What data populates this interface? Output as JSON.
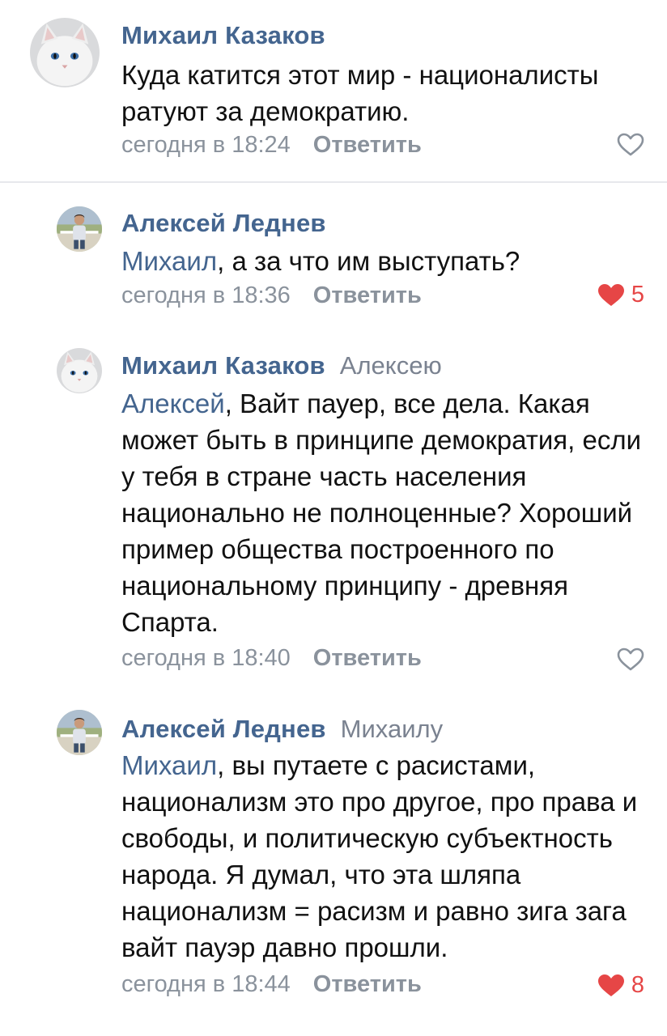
{
  "colors": {
    "author": "#44658f",
    "secondary": "#8a929c",
    "like_active": "#e64646",
    "divider": "#e7e8ec"
  },
  "comments": [
    {
      "author": "Михаил Казаков",
      "reply_to": "",
      "mention": "",
      "text": "Куда катится этот мир - националисты ратуют за демократию.",
      "date": "сегодня в 18:24",
      "reply_label": "Ответить",
      "liked": false,
      "like_count": "",
      "avatar": "white-cat-avatar"
    },
    {
      "author": "Алексей Леднев",
      "reply_to": "",
      "mention": "Михаил",
      "text": ", а за что им выступать?",
      "date": "сегодня в 18:36",
      "reply_label": "Ответить",
      "liked": true,
      "like_count": "5",
      "avatar": "man-photo-avatar"
    },
    {
      "author": "Михаил Казаков",
      "reply_to": "Алексею",
      "mention": "Алексей",
      "text": ", Вайт пауер, все дела. Какая может быть в принципе демократия, если у тебя в стране часть населения национально не полноценные? Хороший пример общества построенного по национальному принципу - древняя Спарта.",
      "date": "сегодня в 18:40",
      "reply_label": "Ответить",
      "liked": false,
      "like_count": "",
      "avatar": "white-cat-avatar"
    },
    {
      "author": "Алексей Леднев",
      "reply_to": "Михаилу",
      "mention": "Михаил",
      "text": ", вы путаете с расистами, национализм это про другое, про права и свободы, и политическую субъектность народа. Я думал, что эта шляпа национализм = расизм и равно зига зага вайт пауэр давно прошли.",
      "date": "сегодня в 18:44",
      "reply_label": "Ответить",
      "liked": true,
      "like_count": "8",
      "avatar": "man-photo-avatar"
    }
  ]
}
